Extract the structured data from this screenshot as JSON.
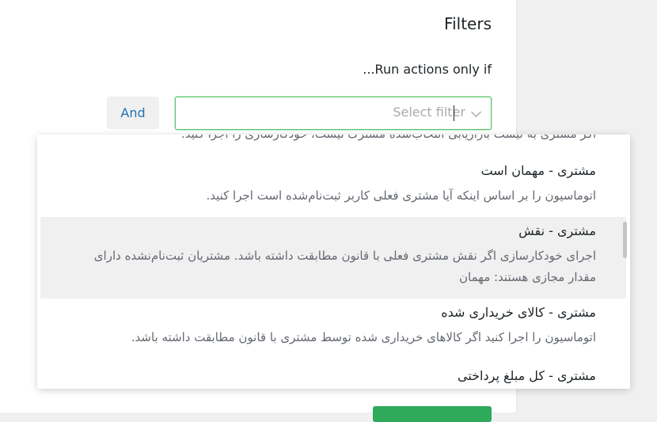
{
  "panel": {
    "title": "Filters",
    "run_label": "...Run actions only if"
  },
  "and_button": {
    "label": "And"
  },
  "filter_select": {
    "placeholder": "Select filter"
  },
  "dropdown": {
    "options": [
      {
        "title": "",
        "description": "اگر مشتری به لیست بازاریابی انتخاب‌شده مشترک نیست، خودکارسازی را اجرا کنید."
      },
      {
        "title": "مشتری - مهمان است",
        "description": "اتوماسیون را بر اساس اینکه آیا مشتری فعلی کاربر ثبت‌نام‌شده است اجرا کنید."
      },
      {
        "title": "مشتری - نقش",
        "description": "اجرای خودکارسازی اگر نقش مشتری فعلی با قانون مطابقت داشته باشد. مشتریان ثبت‌نام‌نشده دارای مقدار مجازی هستند: مهمان"
      },
      {
        "title": "مشتری - کالای خریداری شده",
        "description": "اتوماسیون را اجرا کنید اگر کالاهای خریداری شده توسط مشتری با قانون مطابقت داشته باشد."
      },
      {
        "title": "مشتری - کل مبلغ پرداختی",
        "description": ""
      }
    ]
  },
  "colors": {
    "accent": "#2271b1",
    "focus_border": "#5bc46a",
    "highlight_bg": "#f0f0f1",
    "primary_button": "#2eaa5a"
  }
}
